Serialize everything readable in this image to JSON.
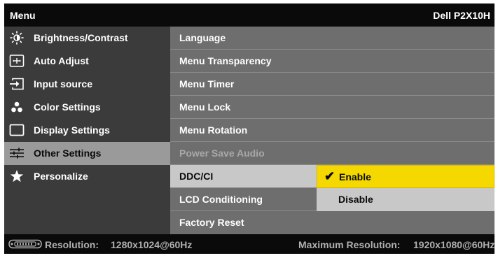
{
  "header": {
    "menu_title": "Menu",
    "model": "Dell P2X10H"
  },
  "sidebar": {
    "items": [
      {
        "label": "Brightness/Contrast",
        "icon": "brightness-icon"
      },
      {
        "label": "Auto Adjust",
        "icon": "auto-adjust-icon"
      },
      {
        "label": "Input source",
        "icon": "input-source-icon"
      },
      {
        "label": "Color Settings",
        "icon": "color-settings-icon"
      },
      {
        "label": "Display Settings",
        "icon": "display-settings-icon"
      },
      {
        "label": "Other Settings",
        "icon": "other-settings-icon",
        "active": true
      },
      {
        "label": "Personalize",
        "icon": "star-icon"
      }
    ]
  },
  "main": {
    "items": [
      {
        "label": "Language"
      },
      {
        "label": "Menu Transparency"
      },
      {
        "label": "Menu Timer"
      },
      {
        "label": "Menu Lock"
      },
      {
        "label": "Menu Rotation"
      },
      {
        "label": "Power Save Audio",
        "disabled": true
      },
      {
        "label": "DDC/CI",
        "selected": true
      },
      {
        "label": "LCD Conditioning"
      },
      {
        "label": "Factory Reset"
      }
    ],
    "ddc_options": {
      "enable": "Enable",
      "disable": "Disable",
      "selected": "Enable"
    }
  },
  "status": {
    "resolution_label": "Resolution:",
    "resolution_value": "1280x1024@60Hz",
    "max_label": "Maximum Resolution:",
    "max_value": "1920x1080@60Hz"
  },
  "colors": {
    "highlight": "#f5d800",
    "active_sidebar": "#9a9a9a",
    "menu_bg": "#6e6e6e"
  }
}
